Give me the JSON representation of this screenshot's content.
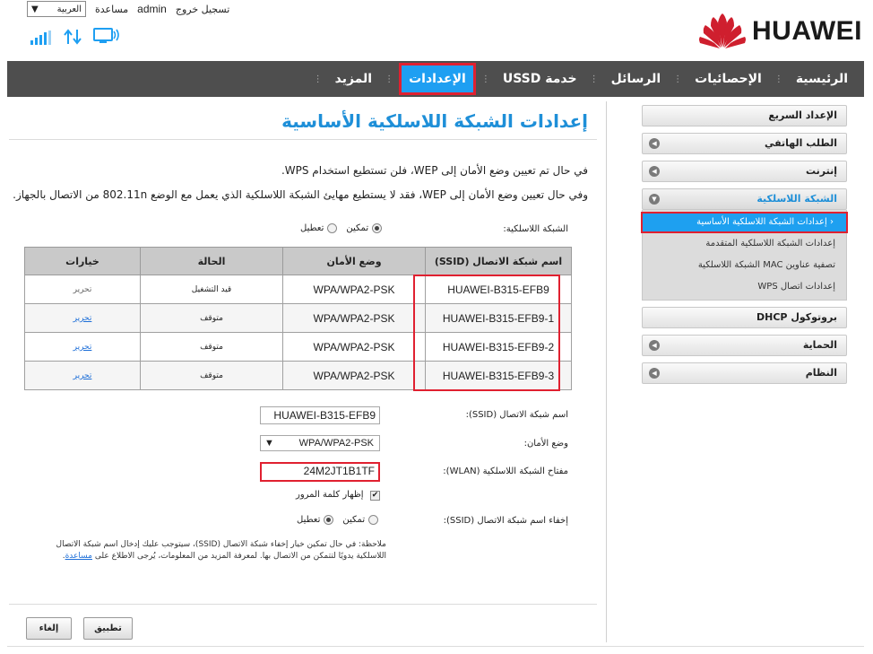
{
  "header": {
    "brand": "HUAWEI",
    "language": "العربية",
    "help": "مساعدة",
    "user": "admin",
    "logout": "تسجيل خروج",
    "accent": "#1e9ff2"
  },
  "nav": {
    "items": [
      {
        "label": "الرئيسية"
      },
      {
        "label": "الإحصائيات"
      },
      {
        "label": "الرسائل"
      },
      {
        "label": "خدمة USSD"
      },
      {
        "label": "الإعدادات"
      },
      {
        "label": "المزيد"
      }
    ]
  },
  "sidebar": {
    "items": [
      {
        "label": "الإعداد السريع"
      },
      {
        "label": "الطلب الهاتفي"
      },
      {
        "label": "إنترنت"
      },
      {
        "label": "الشبكة اللاسلكية"
      },
      {
        "label": "بروتوكول DHCP"
      },
      {
        "label": "الحماية"
      },
      {
        "label": "النظام"
      }
    ],
    "wlan_sub": [
      {
        "label": "إعدادات الشبكة اللاسلكية الأساسية"
      },
      {
        "label": "إعدادات الشبكة اللاسلكية المتقدمة"
      },
      {
        "label": "تصفية عناوين MAC الشبكة اللاسلكية"
      },
      {
        "label": "إعدادات اتصال WPS"
      }
    ]
  },
  "main": {
    "title": "إعدادات الشبكة اللاسلكية الأساسية",
    "note1": "في حال تم تعيين وضع الأمان إلى WEP، فلن تستطيع استخدام WPS.",
    "note2": "وفي حال تعيين وضع الأمان إلى WEP، فقد لا يستطيع مهايئ الشبكة اللاسلكية الذي يعمل مع الوضع 802.11n من الاتصال بالجهاز.",
    "wlan_label": "الشبكة اللاسلكية:",
    "enable": "تمكين",
    "disable": "تعطيل",
    "table": {
      "headers": [
        "اسم شبكة الاتصال (SSID)",
        "وضع الأمان",
        "الحالة",
        "خيارات"
      ],
      "rows": [
        {
          "ssid": "HUAWEI-B315-EFB9",
          "security": "WPA/WPA2-PSK",
          "status": "قيد التشغيل",
          "option": "تحرير"
        },
        {
          "ssid": "HUAWEI-B315-EFB9-1",
          "security": "WPA/WPA2-PSK",
          "status": "متوقف",
          "option": "تحرير"
        },
        {
          "ssid": "HUAWEI-B315-EFB9-2",
          "security": "WPA/WPA2-PSK",
          "status": "متوقف",
          "option": "تحرير"
        },
        {
          "ssid": "HUAWEI-B315-EFB9-3",
          "security": "WPA/WPA2-PSK",
          "status": "متوقف",
          "option": "تحرير"
        }
      ]
    },
    "form": {
      "ssid_label": "اسم شبكة الاتصال (SSID):",
      "ssid_value": "HUAWEI-B315-EFB9",
      "security_label": "وضع الأمان:",
      "security_value": "WPA/WPA2-PSK",
      "key_label": "مفتاح الشبكة اللاسلكية (WLAN):",
      "key_value": "24M2JT1B1TF",
      "show_password": "إظهار كلمة المرور",
      "hide_label": "إخفاء اسم شبكة الاتصال (SSID):",
      "hide_enable": "تمكين",
      "hide_disable": "تعطيل"
    },
    "remark": "ملاحظة: في حال تمكين خيار إخفاء شبكة الاتصال (SSID)، سيتوجب عليك إدخال اسم شبكة الاتصال اللاسلكية يدويًا لتتمكن من الاتصال بها. لمعرفة المزيد من المعلومات، يُرجى الاطلاع على",
    "remark_link": "مساعدة",
    "apply": "تطبيق",
    "cancel": "إلغاء"
  }
}
